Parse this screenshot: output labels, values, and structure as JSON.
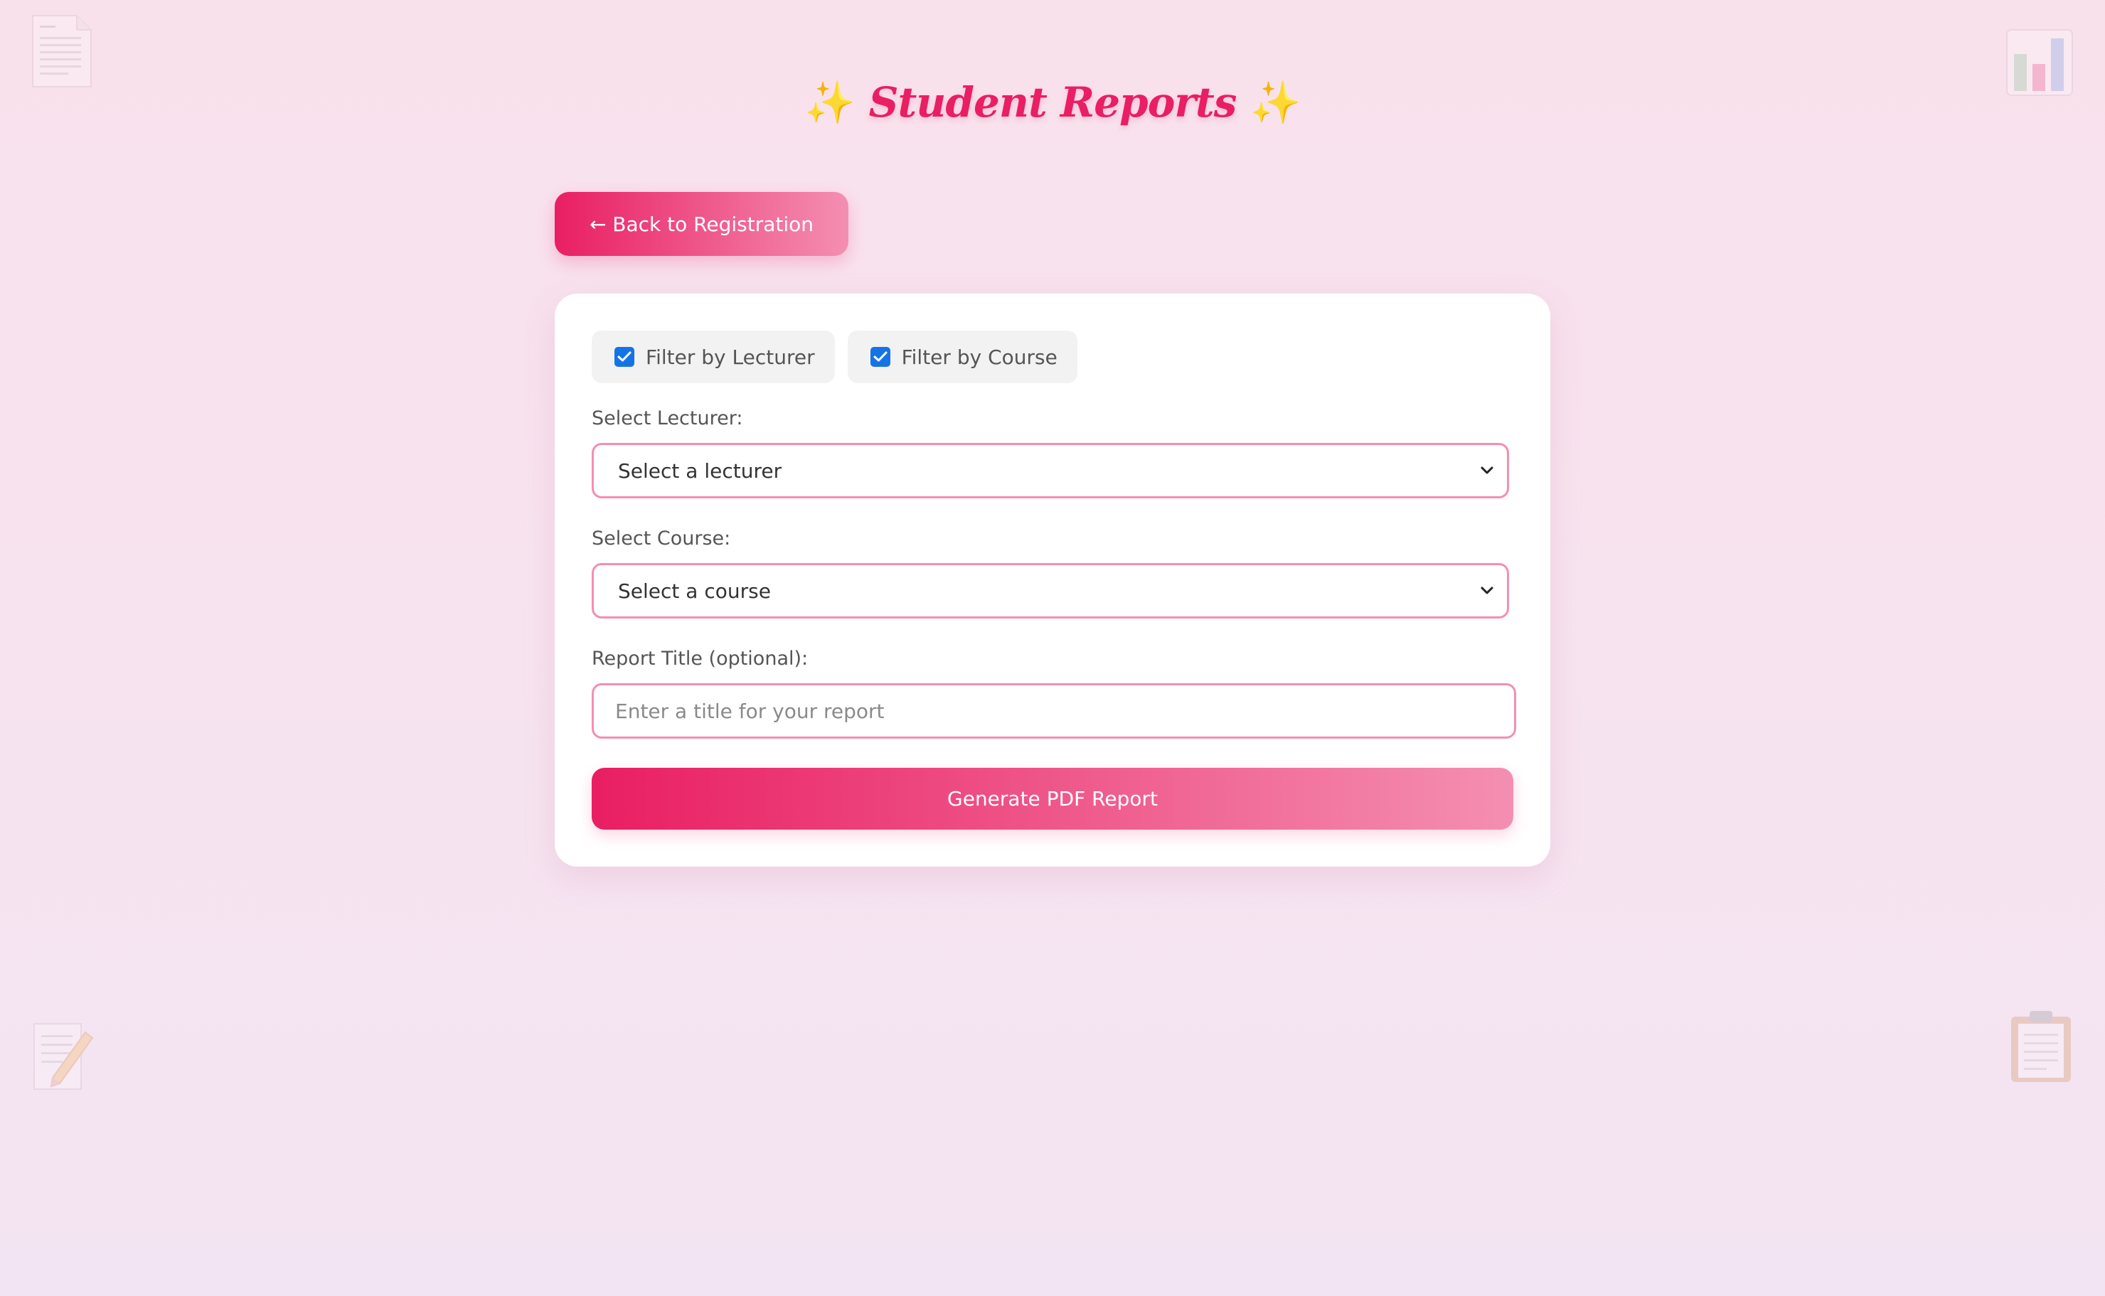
{
  "header": {
    "sparkle_left": "✨",
    "title": "Student Reports",
    "sparkle_right": "✨"
  },
  "nav": {
    "back_label": "← Back to Registration"
  },
  "filters": [
    {
      "label": "Filter by Lecturer",
      "checked": true
    },
    {
      "label": "Filter by Course",
      "checked": true
    }
  ],
  "form": {
    "lecturer_label": "Select Lecturer:",
    "lecturer_value": "Select a lecturer",
    "course_label": "Select Course:",
    "course_value": "Select a course",
    "title_label": "Report Title (optional):",
    "title_placeholder": "Enter a title for your report",
    "title_value": ""
  },
  "actions": {
    "generate_label": "Generate PDF Report"
  },
  "decor_icons": [
    "document-icon",
    "bar-chart-icon",
    "memo-icon",
    "clipboard-icon"
  ],
  "colors": {
    "accent": "#e91e63",
    "accent_light": "#f48fb1",
    "checkbox": "#1673e6"
  }
}
